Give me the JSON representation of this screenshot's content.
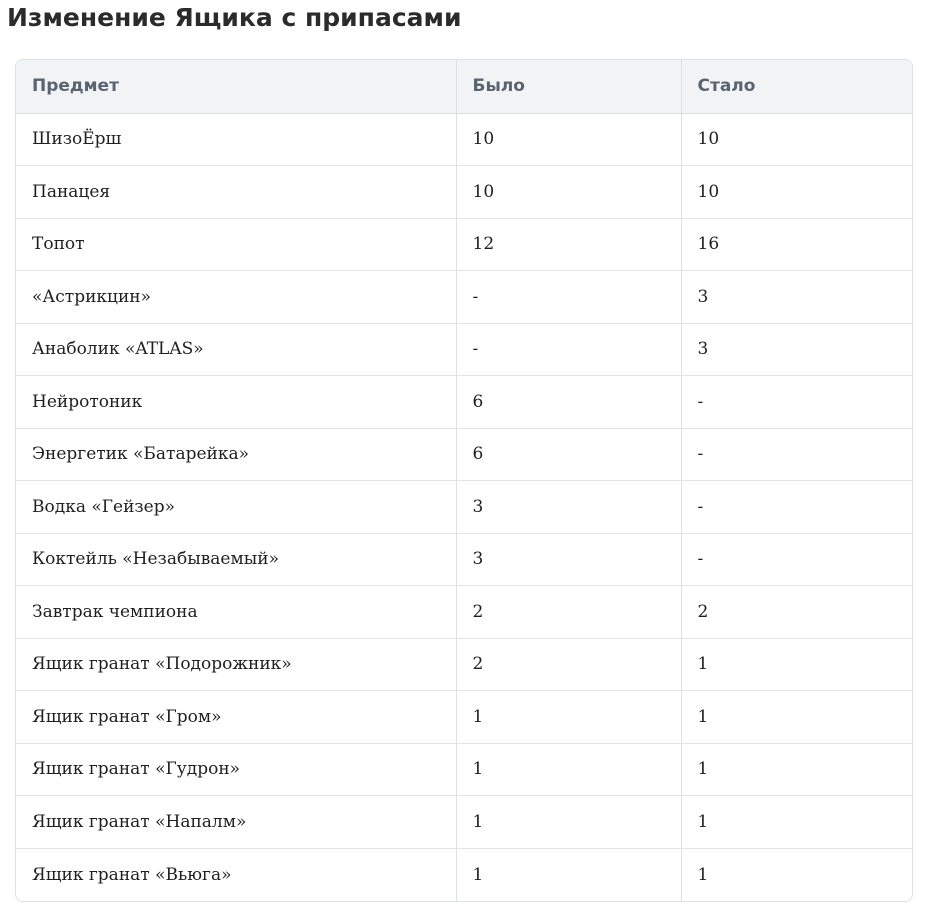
{
  "page": {
    "title": "Изменение Ящика с припасами"
  },
  "table": {
    "headers": [
      "Предмет",
      "Было",
      "Стало"
    ],
    "rows": [
      [
        "ШизоЁрш",
        "10",
        "10"
      ],
      [
        "Панацея",
        "10",
        "10"
      ],
      [
        "Топот",
        "12",
        "16"
      ],
      [
        "«Астрикцин»",
        "-",
        "3"
      ],
      [
        "Анаболик «ATLAS»",
        "-",
        "3"
      ],
      [
        "Нейротоник",
        "6",
        "-"
      ],
      [
        "Энергетик «Батарейка»",
        "6",
        "-"
      ],
      [
        "Водка «Гейзер»",
        "3",
        "-"
      ],
      [
        "Коктейль «Незабываемый»",
        "3",
        "-"
      ],
      [
        "Завтрак чемпиона",
        "2",
        "2"
      ],
      [
        "Ящик гранат «Подорожник»",
        "2",
        "1"
      ],
      [
        "Ящик гранат «Гром»",
        "1",
        "1"
      ],
      [
        "Ящик гранат «Гудрон»",
        "1",
        "1"
      ],
      [
        "Ящик гранат «Напалм»",
        "1",
        "1"
      ],
      [
        "Ящик гранат «Вьюга»",
        "1",
        "1"
      ]
    ]
  }
}
